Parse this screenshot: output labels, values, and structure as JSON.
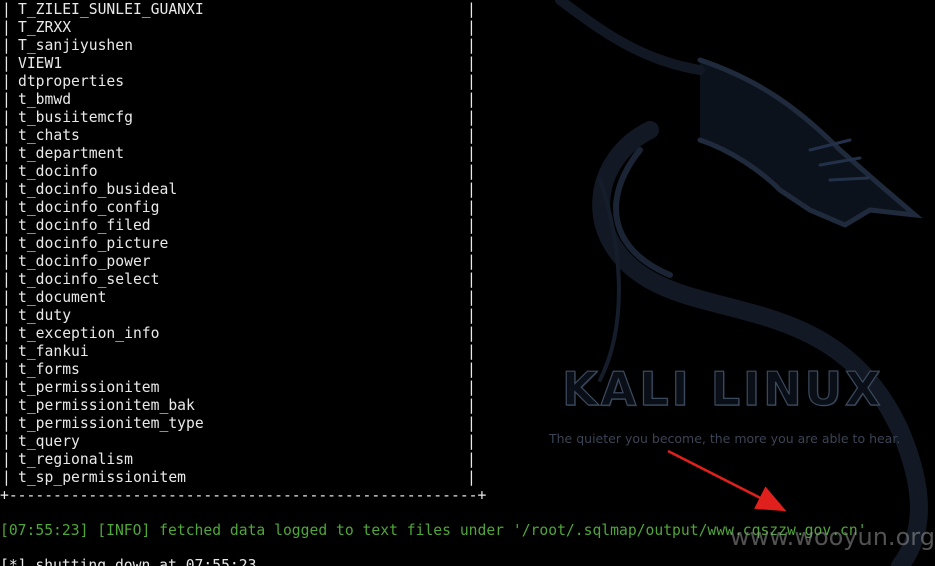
{
  "wallpaper": {
    "logo_text": "KALI LINUX",
    "tagline": "The quieter you become, the more you are able to hear.",
    "dragon_icon": "kali-dragon-icon"
  },
  "terminal": {
    "table_rows": [
      "T_ZILEI_SUNLEI_GUANXI",
      "T_ZRXX",
      "T_sanjiyushen",
      "VIEW1",
      "dtproperties",
      "t_bmwd",
      "t_busiitemcfg",
      "t_chats",
      "t_department",
      "t_docinfo",
      "t_docinfo_busideal",
      "t_docinfo_config",
      "t_docinfo_filed",
      "t_docinfo_picture",
      "t_docinfo_power",
      "t_docinfo_select",
      "t_document",
      "t_duty",
      "t_exception_info",
      "t_fankui",
      "t_forms",
      "t_permissionitem",
      "t_permissionitem_bak",
      "t_permissionitem_type",
      "t_query",
      "t_regionalism",
      "t_sp_permissionitem"
    ],
    "table_border": "+-----------------------------------------------------+",
    "info_line": "[07:55:23] [INFO] fetched data logged to text files under '/root/.sqlmap/output/www.cqszzw.gov.cn'",
    "shutdown_line": "[*] shutting down at 07:55:23"
  },
  "overlay": {
    "watermark": "www.wooyun.org",
    "arrow_color": "#e0201c"
  },
  "colors": {
    "background": "#000000",
    "text": "#e9e9e9",
    "info_green": "#4fa63a"
  }
}
